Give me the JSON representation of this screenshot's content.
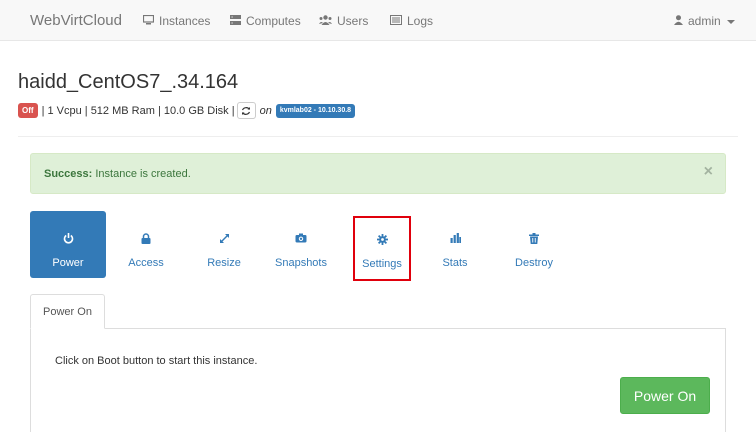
{
  "navbar": {
    "brand": "WebVirtCloud",
    "items": [
      {
        "label": "Instances",
        "icon": "monitor-icon"
      },
      {
        "label": "Computes",
        "icon": "server-icon"
      },
      {
        "label": "Users",
        "icon": "users-icon"
      },
      {
        "label": "Logs",
        "icon": "list-icon"
      }
    ],
    "user": {
      "label": "admin",
      "icon": "user-icon"
    }
  },
  "instance": {
    "name": "haidd_CentOS7_.34.164",
    "status": "Off",
    "specs": "| 1 Vcpu | 512 MB Ram | 10.0 GB Disk |",
    "on_text": "on",
    "host": "kvmlab02 - 10.10.30.8"
  },
  "alert": {
    "strong": "Success:",
    "message": " Instance is created.",
    "close": "×",
    "color": "#dff0d8"
  },
  "tabs": [
    {
      "label": "Power",
      "icon": "power-icon",
      "active": true
    },
    {
      "label": "Access",
      "icon": "lock-icon"
    },
    {
      "label": "Resize",
      "icon": "resize-icon"
    },
    {
      "label": "Snapshots",
      "icon": "camera-icon"
    },
    {
      "label": "Settings",
      "icon": "gear-icon",
      "highlighted": true
    },
    {
      "label": "Stats",
      "icon": "bar-chart-icon"
    },
    {
      "label": "Destroy",
      "icon": "trash-icon"
    }
  ],
  "power_panel": {
    "subtab": "Power On",
    "text": "Click on Boot button to start this instance.",
    "button": "Power On"
  },
  "colors": {
    "primary": "#337ab7",
    "success": "#5cb85c",
    "danger": "#d9534f",
    "highlight": "#e0000c"
  }
}
